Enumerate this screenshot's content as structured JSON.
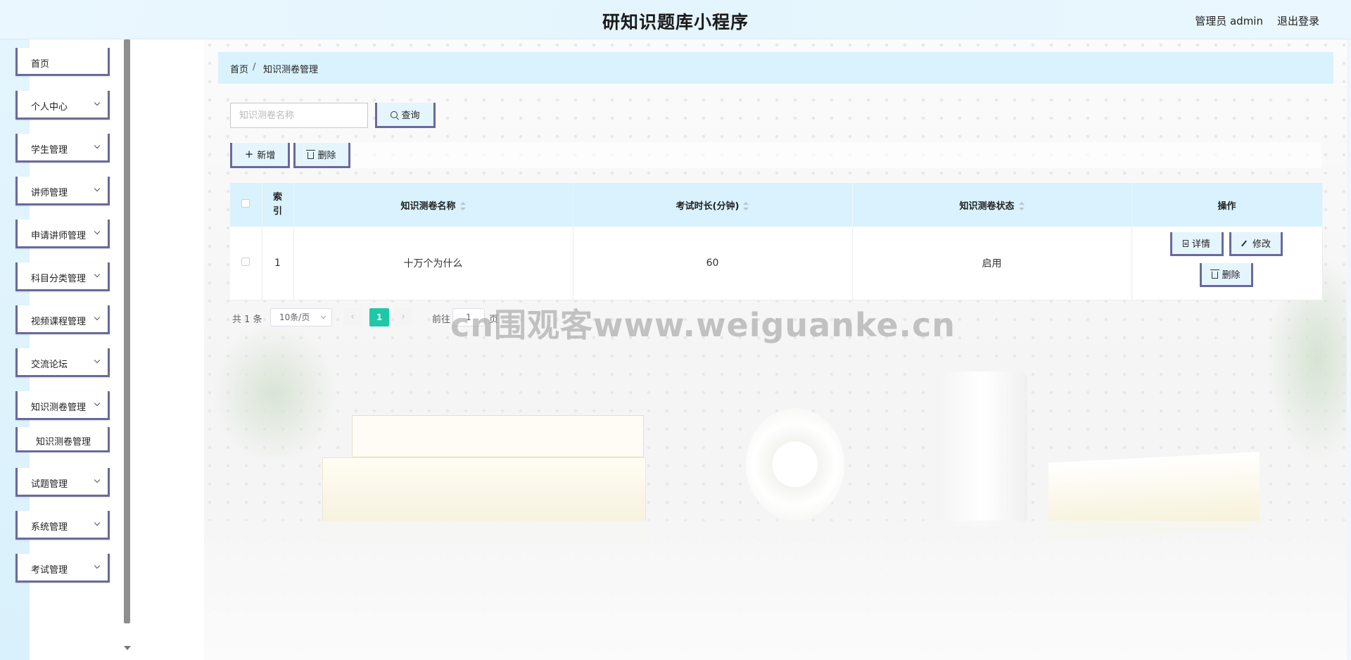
{
  "header": {
    "title": "研知识题库小程序",
    "user": "管理员 admin",
    "logout": "退出登录"
  },
  "sidebar": {
    "items": [
      {
        "label": "首页",
        "expandable": false
      },
      {
        "label": "个人中心",
        "expandable": true
      },
      {
        "label": "学生管理",
        "expandable": true
      },
      {
        "label": "讲师管理",
        "expandable": true
      },
      {
        "label": "申请讲师管理",
        "expandable": true
      },
      {
        "label": "科目分类管理",
        "expandable": true
      },
      {
        "label": "视频课程管理",
        "expandable": true
      },
      {
        "label": "交流论坛",
        "expandable": true
      },
      {
        "label": "知识测卷管理",
        "expandable": true,
        "expanded": true
      },
      {
        "label": "试题管理",
        "expandable": true
      },
      {
        "label": "系统管理",
        "expandable": true
      },
      {
        "label": "考试管理",
        "expandable": true
      }
    ],
    "submenu": {
      "label": "知识测卷管理"
    }
  },
  "breadcrumb": {
    "home": "首页",
    "separator": "/",
    "current": "知识测卷管理"
  },
  "search": {
    "placeholder": "知识测卷名称",
    "value": "",
    "button": "查询"
  },
  "toolbar": {
    "add": "新增",
    "delete": "删除"
  },
  "table": {
    "columns": [
      "索引",
      "知识测卷名称",
      "考试时长(分钟)",
      "知识测卷状态",
      "操作"
    ],
    "rows": [
      {
        "index": "1",
        "name": "十万个为什么",
        "duration": "60",
        "status": "启用"
      }
    ],
    "actions": {
      "detail": "详情",
      "edit": "修改",
      "delete": "删除"
    }
  },
  "pagination": {
    "total": "共 1 条",
    "page_size": "10条/页",
    "current_page": "1",
    "goto_prefix": "前往",
    "goto_value": "1",
    "goto_suffix": "页",
    "prev": "‹",
    "next": "›"
  },
  "watermark": "cn围观客www.weiguanke.cn",
  "colors": {
    "header_bg": "#e4f5fd",
    "accent_border": "#6a6a9a",
    "active_page": "#1ec8a6",
    "table_header_bg": "#d9f2fd"
  }
}
